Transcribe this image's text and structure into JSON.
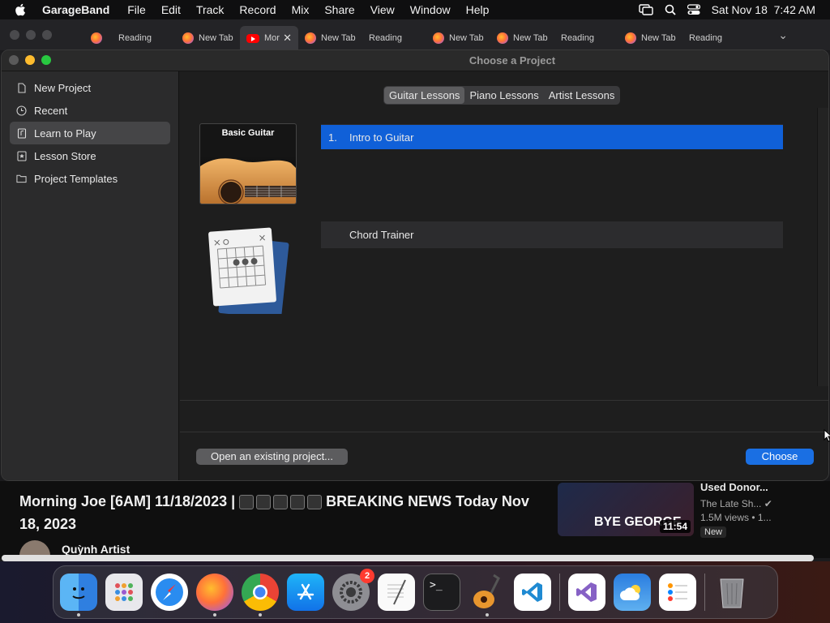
{
  "menubar": {
    "app_name": "GarageBand",
    "menus": [
      "File",
      "Edit",
      "Track",
      "Record",
      "Mix",
      "Share",
      "View",
      "Window",
      "Help"
    ],
    "datetime": "Sat Nov 18  7:42 AM"
  },
  "browser_tabs": [
    {
      "label": "Reading",
      "icon": "firefox-icon",
      "active": false
    },
    {
      "label": "New Tab",
      "icon": "firefox-icon",
      "active": false
    },
    {
      "label": "Mor",
      "icon": "youtube-icon",
      "active": true
    },
    {
      "label": "New Tab",
      "icon": "firefox-icon",
      "active": false
    },
    {
      "label": "Reading",
      "icon": "none",
      "active": false
    },
    {
      "label": "New Tab",
      "icon": "firefox-icon",
      "active": false
    },
    {
      "label": "New Tab",
      "icon": "firefox-icon",
      "active": false
    },
    {
      "label": "Reading",
      "icon": "none",
      "active": false
    },
    {
      "label": "New Tab",
      "icon": "firefox-icon",
      "active": false
    },
    {
      "label": "Reading",
      "icon": "none",
      "active": false
    }
  ],
  "window": {
    "title": "Choose a Project"
  },
  "sidebar": {
    "items": [
      {
        "label": "New Project",
        "icon": "document-icon",
        "selected": false
      },
      {
        "label": "Recent",
        "icon": "clock-icon",
        "selected": false
      },
      {
        "label": "Learn to Play",
        "icon": "lesson-book-icon",
        "selected": true
      },
      {
        "label": "Lesson Store",
        "icon": "star-icon",
        "selected": false
      },
      {
        "label": "Project Templates",
        "icon": "folder-icon",
        "selected": false
      }
    ]
  },
  "segments": {
    "items": [
      "Guitar Lessons",
      "Piano Lessons",
      "Artist Lessons"
    ],
    "selected": "Guitar Lessons"
  },
  "lessons": {
    "basic_guitar_label": "Basic Guitar",
    "rows": [
      {
        "number": "1.",
        "title": "Intro to Guitar",
        "selected": true
      },
      {
        "number": "",
        "title": "Chord Trainer",
        "selected": false
      }
    ]
  },
  "footer": {
    "open_label": "Open an existing project...",
    "choose_label": "Choose"
  },
  "youtube": {
    "title_part1": "Morning Joe [6AM] 11/18/2023 |",
    "title_part2": "BREAKING NEWS Today Nov 18, 2023",
    "channel": "Quỳnh Artist",
    "side_title": "Used Donor...",
    "side_channel": "The Late Sh...",
    "side_views": "1.5M views  • 1...",
    "side_badge": "New",
    "thumb_text": "BYE GEORGE",
    "thumb_duration": "11:54"
  },
  "dock": {
    "apps": [
      "Finder",
      "Launchpad",
      "Safari",
      "Firefox",
      "Chrome",
      "App Store",
      "System Settings",
      "TextEdit",
      "Terminal",
      "GarageBand",
      "VS Code",
      "Visual Studio",
      "Weather",
      "Reminders",
      "Trash"
    ],
    "settings_badge": "2"
  },
  "colors": {
    "accent_blue": "#1060d8",
    "choose_blue": "#1a6fe3"
  }
}
